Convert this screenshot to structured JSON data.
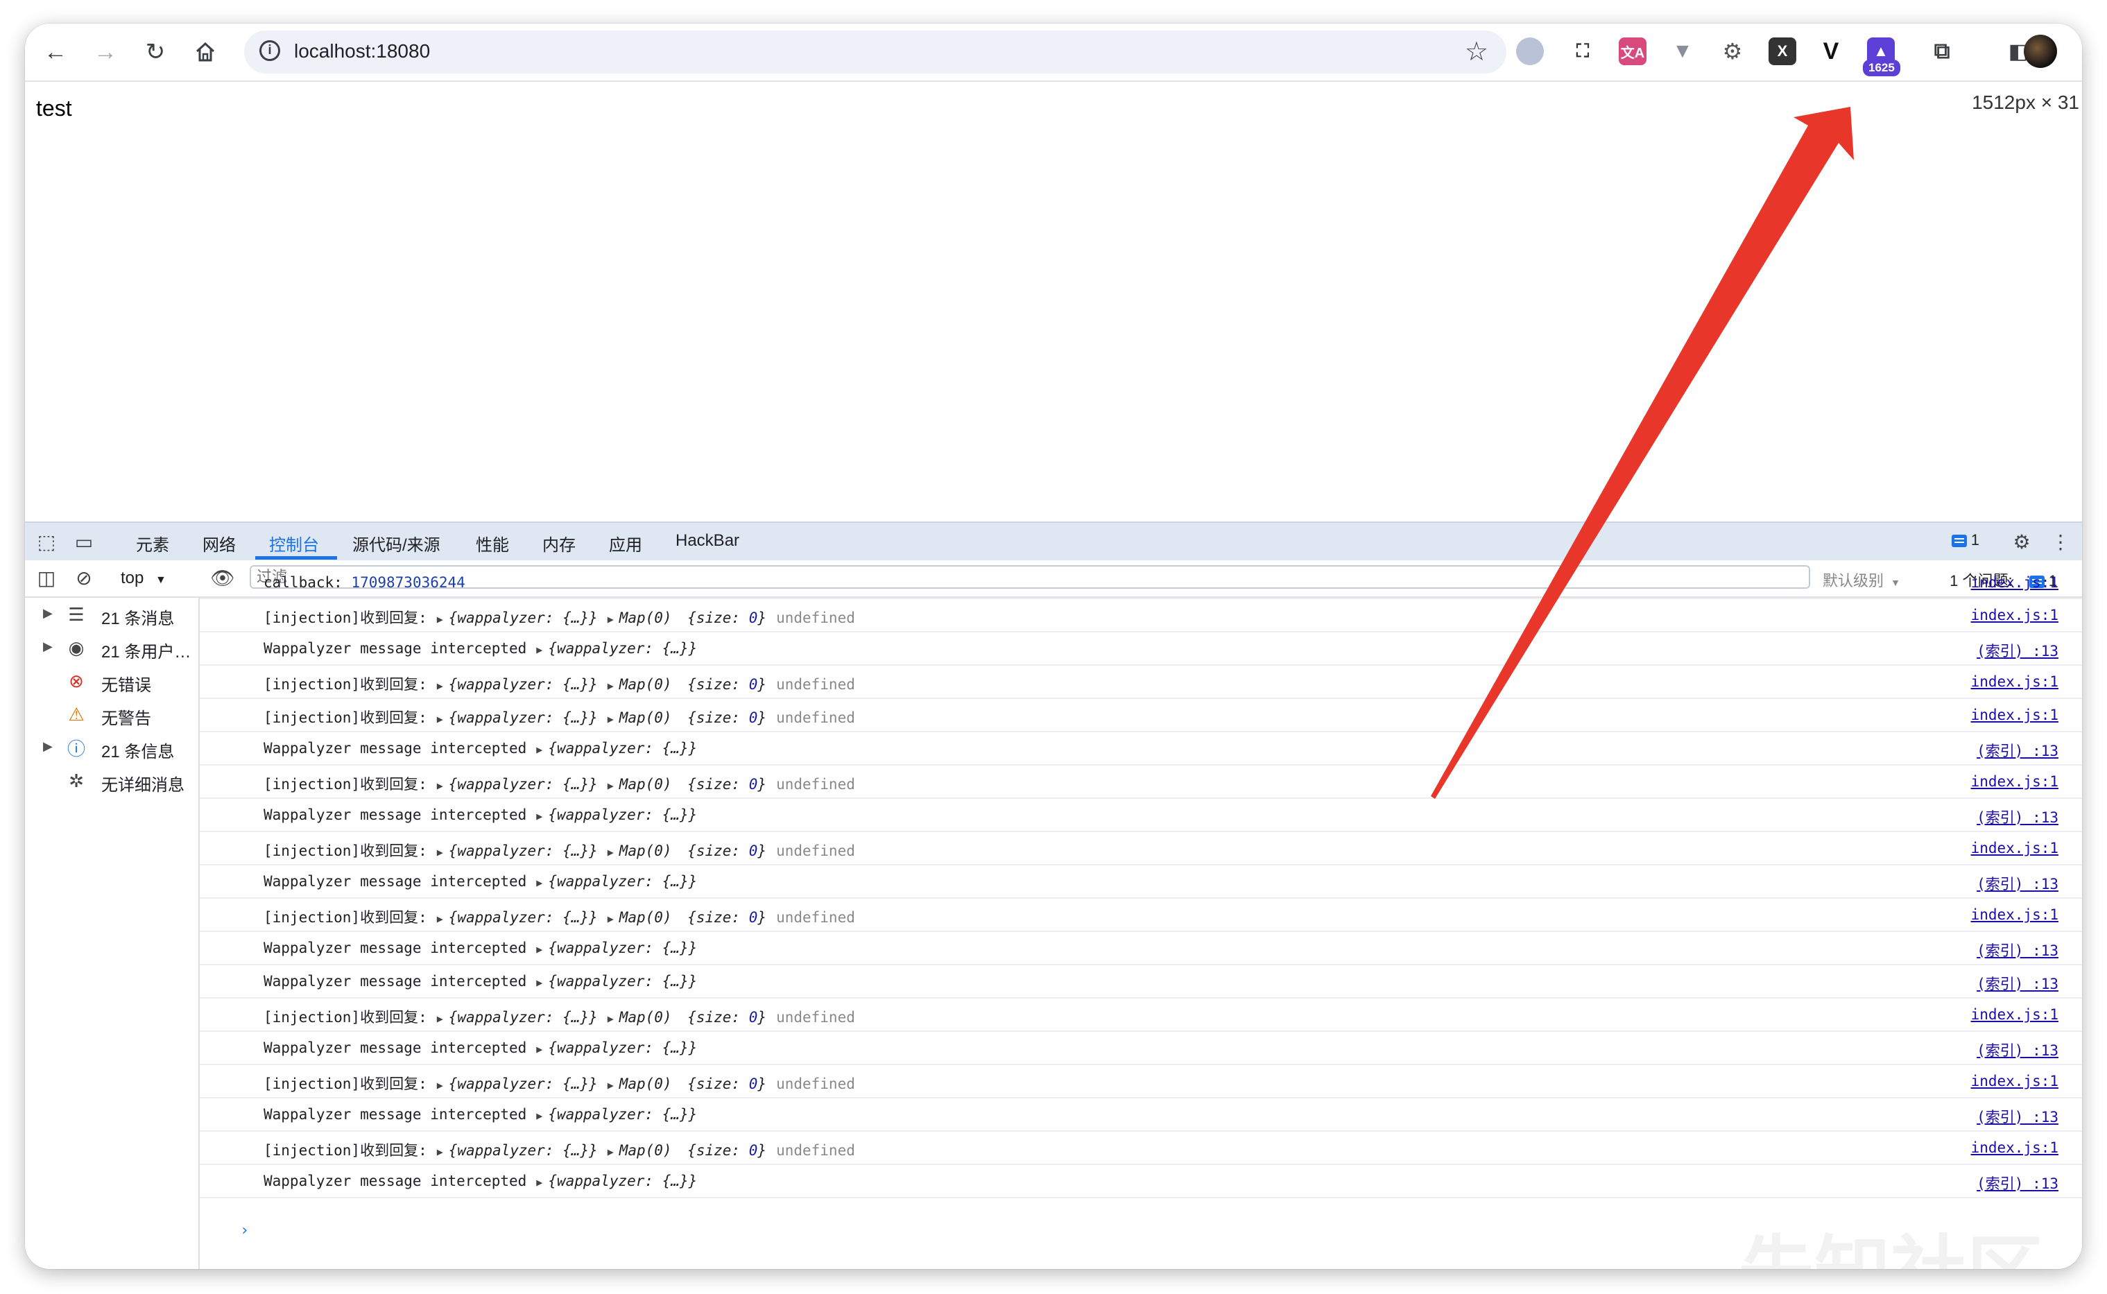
{
  "browser": {
    "url": "localhost:18080",
    "ext_badge": "1625"
  },
  "page": {
    "text": "test",
    "dimension_readout": "1512px × 31"
  },
  "devtools": {
    "tabs": [
      "元素",
      "网络",
      "控制台",
      "源代码/来源",
      "性能",
      "内存",
      "应用",
      "HackBar"
    ],
    "active_tab": "控制台",
    "issues_badge": "1",
    "context": "top",
    "filter_placeholder": "过滤",
    "levels": "默认级别",
    "issue_count_label": "1 个问题:",
    "issue_count": "1",
    "sidebar": [
      {
        "label": "21 条消息",
        "icon": "list-icon",
        "expandable": true
      },
      {
        "label": "21 条用户…",
        "icon": "user-icon",
        "expandable": true
      },
      {
        "label": "无错误",
        "icon": "error-icon",
        "expandable": false
      },
      {
        "label": "无警告",
        "icon": "warning-icon",
        "expandable": false
      },
      {
        "label": "21 条信息",
        "icon": "info-icon",
        "expandable": true
      },
      {
        "label": "无详细消息",
        "icon": "bug-icon",
        "expandable": false
      }
    ],
    "console": {
      "callback_label": "callback:",
      "callback_value": "1709873036244",
      "callback_source": "index.js:1",
      "injection": {
        "prefix": "[injection]收到回复:",
        "obj": "{wappalyzer: {…}}",
        "map": "Map(0)",
        "size_key": "{size: ",
        "size_val": "0",
        "size_close": "}",
        "undef": "undefined",
        "source": "index.js:1"
      },
      "wapp": {
        "prefix": "Wappalyzer message intercepted",
        "obj": "{wappalyzer: {…}}",
        "source": "(索引) :13"
      },
      "rows": [
        "inj",
        "wapp",
        "inj",
        "inj",
        "wapp",
        "inj",
        "wapp",
        "inj",
        "wapp",
        "inj",
        "wapp",
        "wapp",
        "inj",
        "wapp",
        "inj",
        "wapp",
        "inj",
        "wapp"
      ]
    },
    "prompt": "›"
  },
  "watermark": "先知社区",
  "colors": {
    "accent": "#1a73e8",
    "arrow": "#e8372a",
    "tabbar": "#dfe7f3"
  }
}
